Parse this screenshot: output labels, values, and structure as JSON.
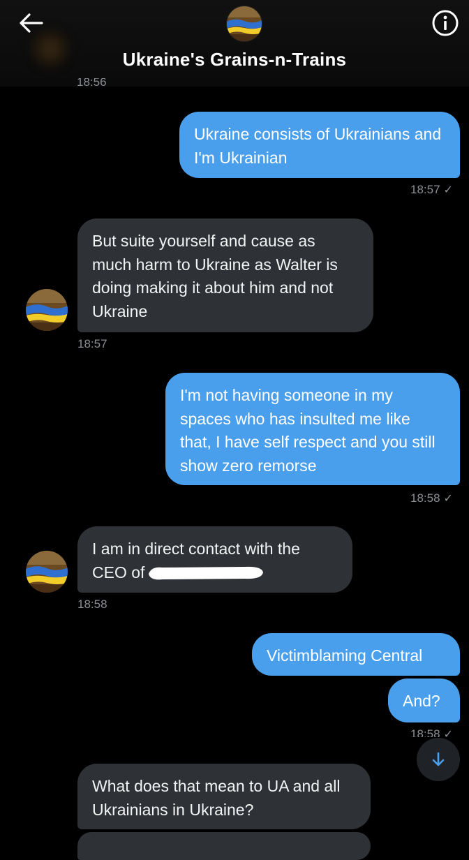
{
  "header": {
    "title": "Ukraine's Grains-n-Trains",
    "back_icon": "arrow-left-icon",
    "info_icon": "info-icon"
  },
  "cut_timestamp": "18:56",
  "messages": [
    {
      "side": "out",
      "text": "Ukraine consists of Ukrainians and I'm Ukrainian",
      "time": "18:57",
      "check": "✓"
    },
    {
      "side": "in",
      "text": "But suite yourself and cause as much harm to Ukraine as Walter is doing making it about him and not Ukraine",
      "time": "18:57"
    },
    {
      "side": "out",
      "text": "I'm not having someone in my spaces who has insulted me like that, I have self respect and you still show zero remorse",
      "time": "18:58",
      "check": "✓"
    },
    {
      "side": "in",
      "text_line1": "I am in direct contact with the",
      "text_line2_prefix": "CEO of",
      "time": "18:58"
    },
    {
      "side": "out",
      "text": "Victimblaming Central"
    },
    {
      "side": "out",
      "text": "And?",
      "time": "18:58",
      "check": "✓"
    },
    {
      "side": "in",
      "text": "What does that mean to UA and all Ukrainians in Ukraine?"
    }
  ],
  "colors": {
    "outgoing_bubble": "#4a9fec",
    "incoming_bubble": "#2e3236",
    "background": "#000000",
    "timestamp": "#8b8f94"
  },
  "scroll_button_icon": "arrow-down-icon"
}
